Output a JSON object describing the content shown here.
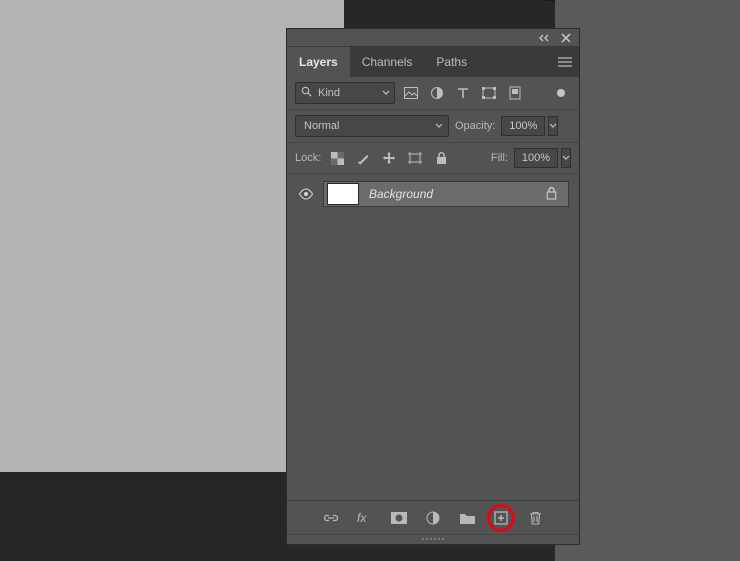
{
  "tabs": {
    "layers": "Layers",
    "channels": "Channels",
    "paths": "Paths"
  },
  "filter": "Kind",
  "blend_mode": "Normal",
  "opacity": {
    "label": "Opacity:",
    "value": "100%"
  },
  "lock": {
    "label": "Lock:"
  },
  "fill": {
    "label": "Fill:",
    "value": "100%"
  },
  "layer": {
    "name": "Background"
  }
}
